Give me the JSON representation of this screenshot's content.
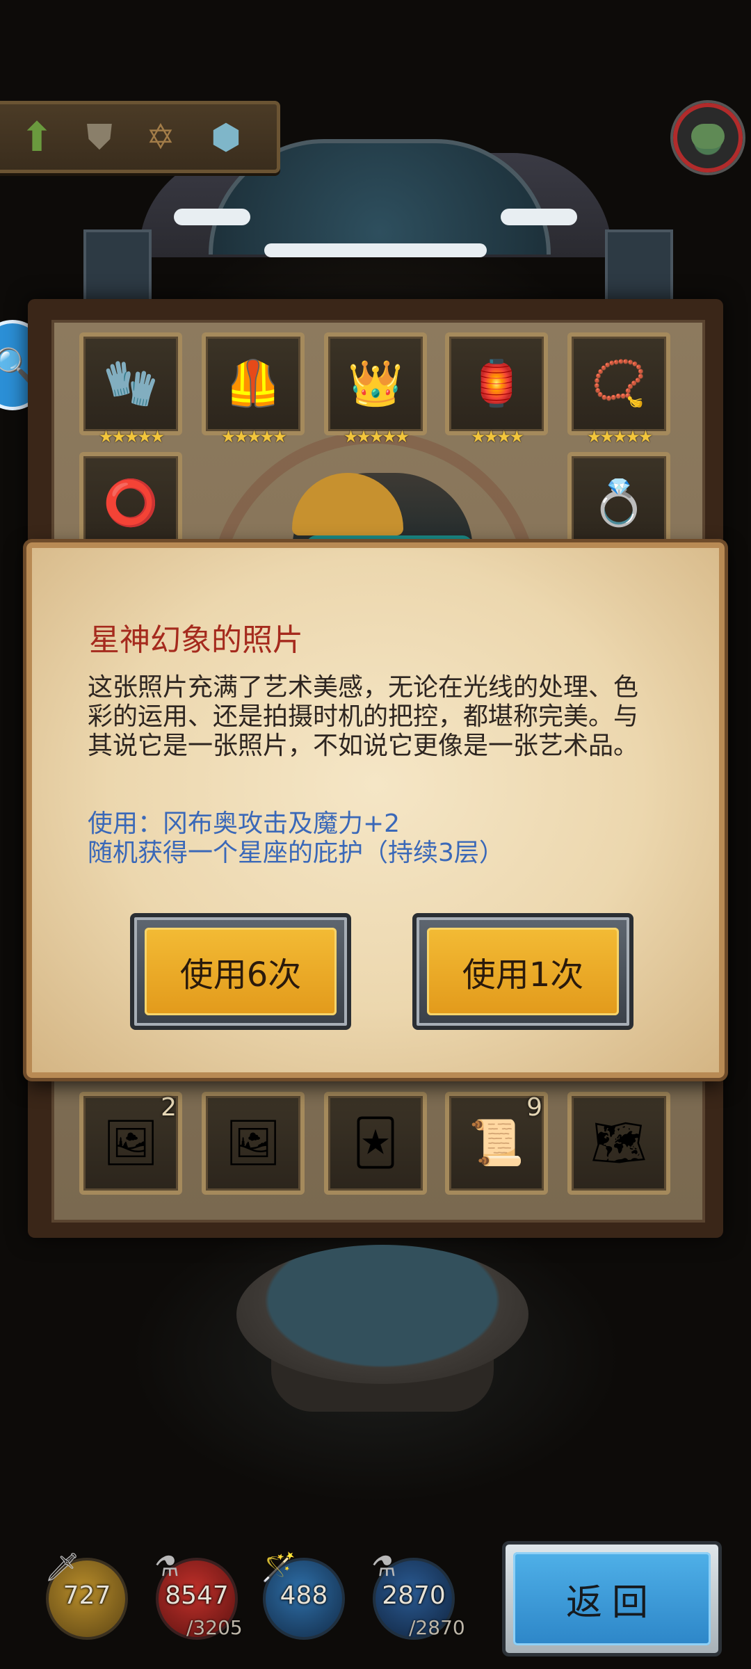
{
  "tabs": [
    {
      "name": "upgrade-arrow-icon",
      "glyph": "⬆"
    },
    {
      "name": "shield-icon",
      "glyph": "⛊"
    },
    {
      "name": "hexagram-icon",
      "glyph": "✡"
    },
    {
      "name": "turtle-shell-icon",
      "glyph": "⬢"
    }
  ],
  "equipment": [
    {
      "name": "gauntlet",
      "glyph": "🧤",
      "stars": "★★★★★"
    },
    {
      "name": "chainmail",
      "glyph": "🦺",
      "stars": "★★★★★"
    },
    {
      "name": "crown",
      "glyph": "👑",
      "stars": "★★★★★"
    },
    {
      "name": "lantern",
      "glyph": "🏮",
      "stars": "★★★★"
    },
    {
      "name": "amulet",
      "glyph": "📿",
      "stars": "★★★★★"
    },
    {
      "name": "belt",
      "glyph": "⭕",
      "stars": ""
    },
    {
      "name": "ring",
      "glyph": "💍",
      "stars": ""
    }
  ],
  "items": [
    {
      "name": "photo",
      "glyph": "🖼",
      "count": "2"
    },
    {
      "name": "photo",
      "glyph": "🖼",
      "count": ""
    },
    {
      "name": "card",
      "glyph": "🃏",
      "count": ""
    },
    {
      "name": "scroll-book",
      "glyph": "📜",
      "count": "9"
    },
    {
      "name": "map",
      "glyph": "🗺",
      "count": ""
    }
  ],
  "dialog": {
    "title": "星神幻象的照片",
    "description": "这张照片充满了艺术美感，无论在光线的处理、色彩的运用、还是拍摄时机的把控，都堪称完美。与其说它是一张照片，不如说它更像是一张艺术品。",
    "effect_line1": "使用：冈布奥攻击及魔力+2",
    "effect_line2": "随机获得一个星座的庇护（持续3层）",
    "use6_label": "使用6次",
    "use1_label": "使用1次"
  },
  "stats": {
    "attack": "727",
    "hp": "8547",
    "hp_max": "/3205",
    "magic": "488",
    "mp": "2870",
    "mp_max": "/2870"
  },
  "back_label": "返回",
  "colors": {
    "title_red": "#a52a1d",
    "effect_blue": "#3a68b8",
    "button_gold": "#e29a1b",
    "back_blue": "#2d86c8"
  }
}
